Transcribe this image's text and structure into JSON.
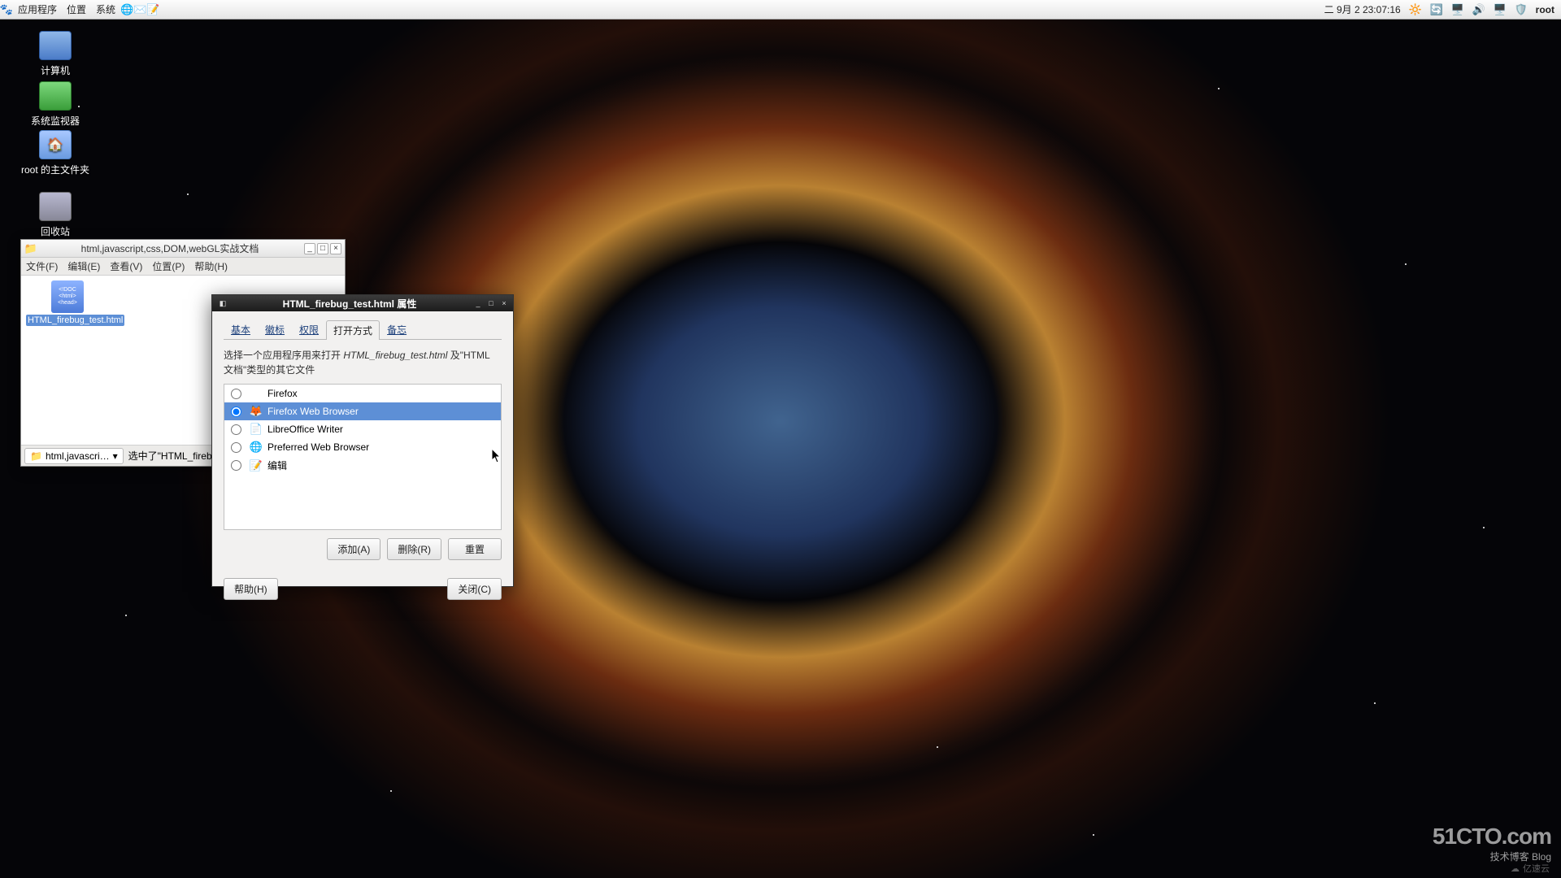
{
  "panel": {
    "menus": [
      "应用程序",
      "位置",
      "系统"
    ],
    "clock": "二 9月  2 23:07:16",
    "user": "root"
  },
  "desktop_icons": [
    {
      "label": "计算机"
    },
    {
      "label": "系统监视器"
    },
    {
      "label": "root 的主文件夹"
    },
    {
      "label": "回收站"
    }
  ],
  "fm": {
    "title": "html,javascript,css,DOM,webGL实战文档",
    "menus": [
      "文件(F)",
      "编辑(E)",
      "查看(V)",
      "位置(P)",
      "帮助(H)"
    ],
    "file": {
      "name": "HTML_firebug_test.html",
      "badge_lines": [
        "<!DOC",
        "<html>",
        "<head>"
      ]
    },
    "crumb": "html,javascri…",
    "status": "选中了\"HTML_firebug_te"
  },
  "prop": {
    "title": "HTML_firebug_test.html 属性",
    "tabs": [
      "基本",
      "徽标",
      "权限",
      "打开方式",
      "备忘"
    ],
    "active_tab": 3,
    "prompt_prefix": "选择一个应用程序用来打开 ",
    "prompt_filename": "HTML_firebug_test.html",
    "prompt_suffix": " 及\"HTML 文档\"类型的其它文件",
    "apps": [
      {
        "name": "Firefox"
      },
      {
        "name": "Firefox Web Browser"
      },
      {
        "name": "LibreOffice Writer"
      },
      {
        "name": "Preferred Web Browser"
      },
      {
        "name": "编辑"
      }
    ],
    "selected_app": 1,
    "buttons": {
      "add": "添加(A)",
      "remove": "删除(R)",
      "reset": "重置",
      "help": "帮助(H)",
      "close": "关闭(C)"
    }
  },
  "watermark": {
    "big": "51CTO.com",
    "sm": "技术博客   Blog",
    "corner": "亿速云"
  }
}
